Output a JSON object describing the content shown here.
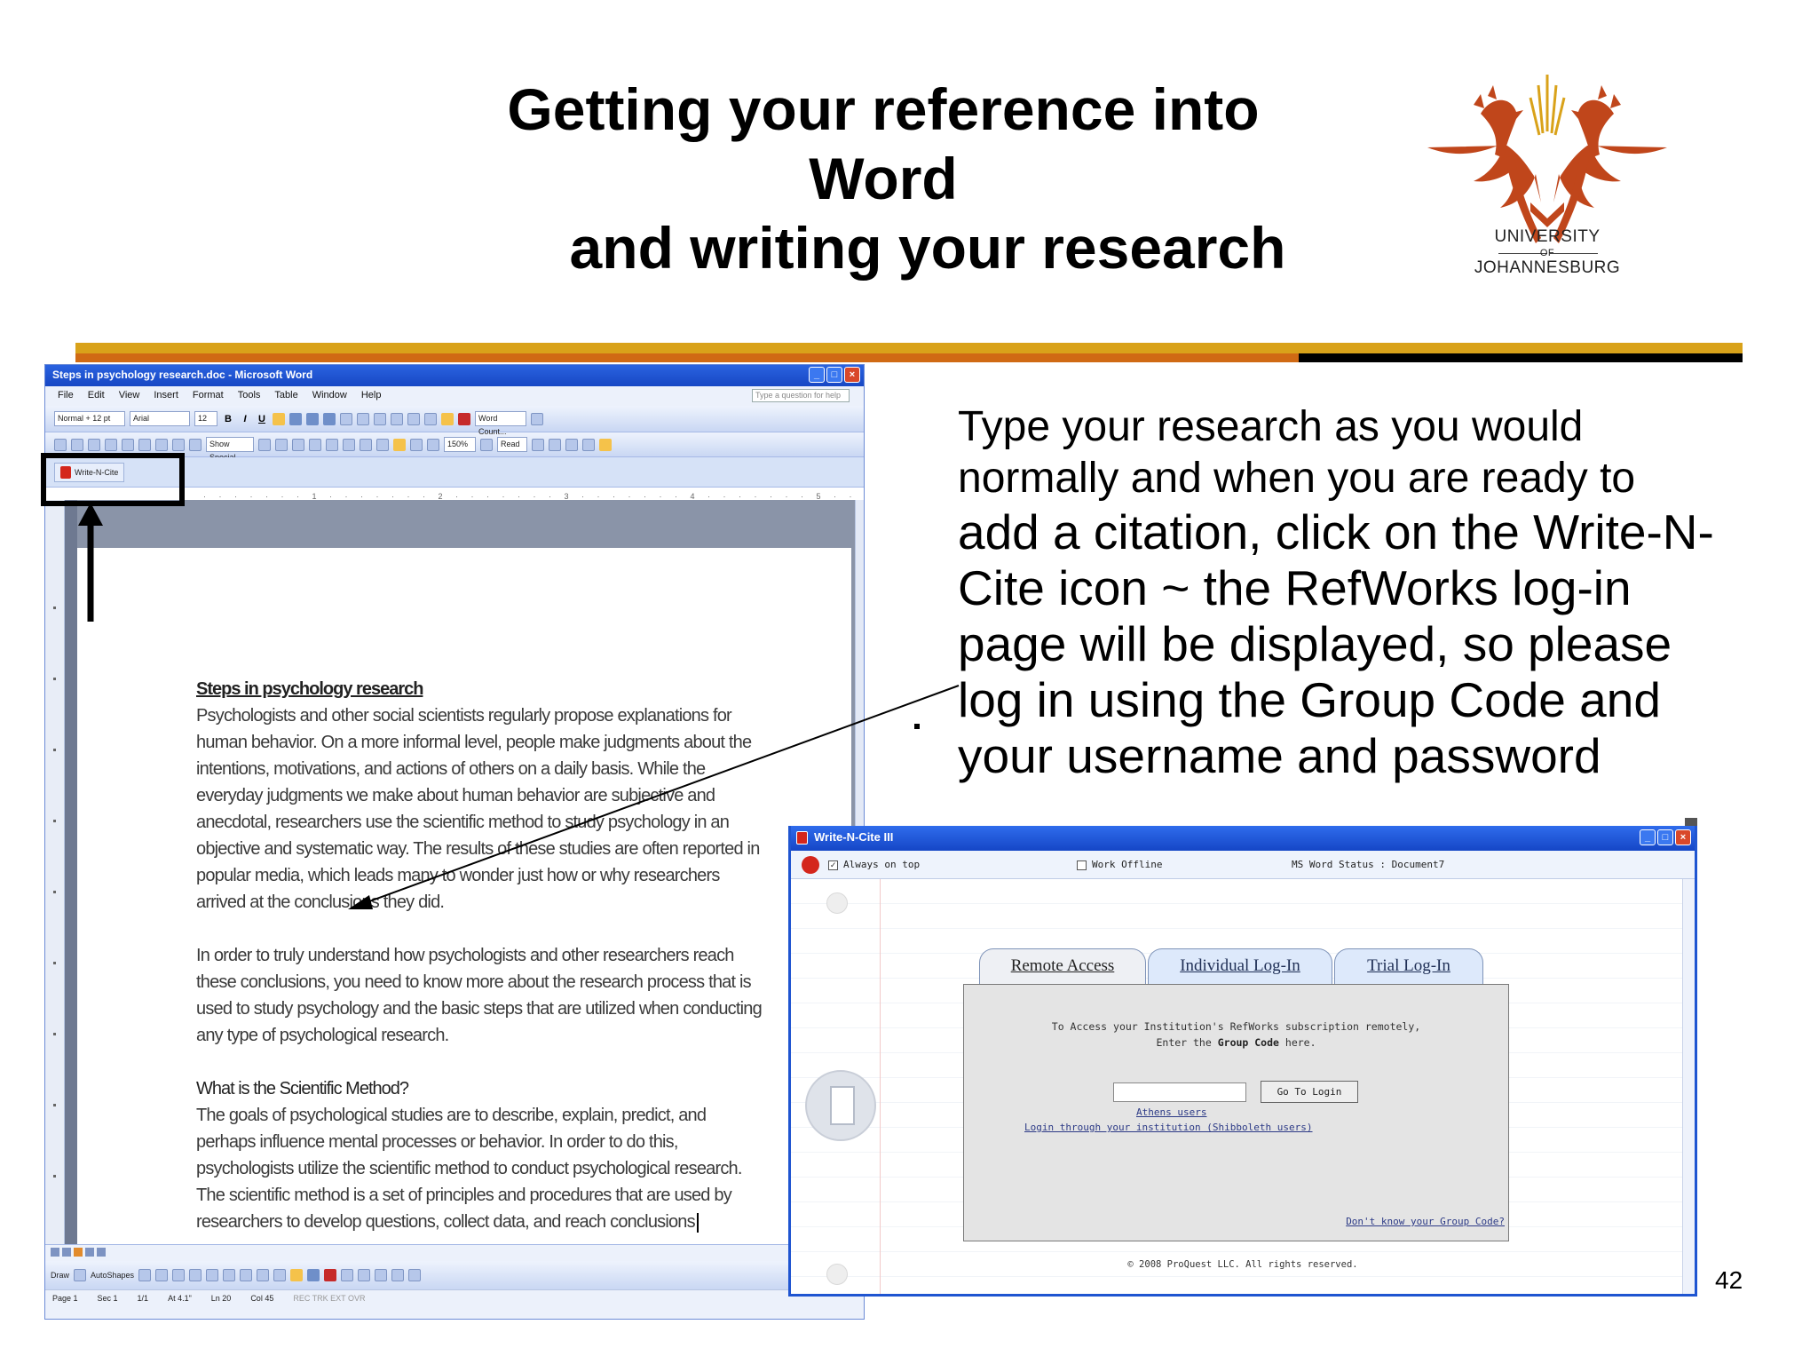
{
  "slide": {
    "title_line1": "Getting your reference into Word",
    "title_line2": "and writing your research",
    "page_number": "42",
    "body_line1": "Type your research as you would",
    "body_line2": "normally and when you are ready to",
    "body_line3": "add a citation, click on the Write-N-",
    "body_line4": "Cite icon ~ the RefWorks log-in",
    "body_line5": "page will be displayed, so please",
    "body_line6": "log in using the Group Code and",
    "body_line7": "your username and password",
    "stray_mark": "."
  },
  "logo": {
    "line1": "UNIVERSITY",
    "line2": "OF",
    "line3": "JOHANNESBURG",
    "icon": "university-crest-icon",
    "color": "#c0461b"
  },
  "colors": {
    "rule_gold": "#d9a21a",
    "rule_orange": "#d06a14",
    "rule_black": "#000000",
    "xp_blue": "#1f55d1"
  },
  "word": {
    "window_title": "Steps in psychology research.doc - Microsoft Word",
    "menu": [
      "File",
      "Edit",
      "View",
      "Insert",
      "Format",
      "Tools",
      "Table",
      "Window",
      "Help"
    ],
    "help_placeholder": "Type a question for help",
    "style_box": "Normal + 12 pt",
    "font_box": "Arial",
    "size_box": "12",
    "word_count": "Word Count...",
    "zoom": "150%",
    "show_special": "Show Special...",
    "read_button": "Read",
    "write_n_cite_button": "Write-N-Cite",
    "draw_label": "Draw",
    "autoshapes_label": "AutoShapes",
    "status": {
      "page": "Page 1",
      "sec": "Sec 1",
      "pages": "1/1",
      "at": "At 4.1\"",
      "ln": "Ln 20",
      "col": "Col 45",
      "modes": "REC  TRK  EXT  OVR"
    },
    "document": {
      "heading1": "Steps in psychology research",
      "para1": "Psychologists and other social scientists regularly propose explanations for human behavior. On a more informal level, people make judgments about the intentions, motivations, and actions of others on a daily basis. While the everyday judgments we make about human behavior are subjective and anecdotal, researchers use the scientific method to study psychology in an objective and systematic way. The results of these studies are often reported in popular media, which leads many to wonder just how or why researchers arrived at the conclusions they did.",
      "para2": "In order to truly understand how psychologists and other researchers reach these conclusions, you need to know more about the research process that is used to study psychology and the basic steps that are utilized when conducting any type of psychological research.",
      "heading2": "What is the Scientific Method?",
      "para3": "The goals of psychological studies are to describe, explain, predict, and perhaps influence mental processes or behavior. In order to do this, psychologists utilize the scientific method to conduct psychological research. The scientific method is a set of principles and procedures that are used by researchers to develop questions, collect data, and reach conclusions"
    }
  },
  "write_n_cite": {
    "window_title": "Write-N-Cite III",
    "always_on_top": "Always on top",
    "always_on_top_checked": "✓",
    "work_offline": "Work Offline",
    "ms_word_status": "MS Word Status : Document7",
    "tabs": [
      "Remote Access",
      "Individual Log-In",
      "Trial Log-In"
    ],
    "active_tab": "Remote Access",
    "message_line1": "To Access your Institution's RefWorks subscription remotely,",
    "message_prefix": "Enter the ",
    "message_bold": "Group Code",
    "message_suffix": " here.",
    "group_code_value": "",
    "go_button": "Go To Login",
    "athens_link": "Athens users",
    "shibboleth_link": "Login through your institution (Shibboleth users)",
    "forgot_link": "Don't know your Group Code?",
    "copyright": "© 2008 ProQuest LLC.  All rights reserved."
  }
}
